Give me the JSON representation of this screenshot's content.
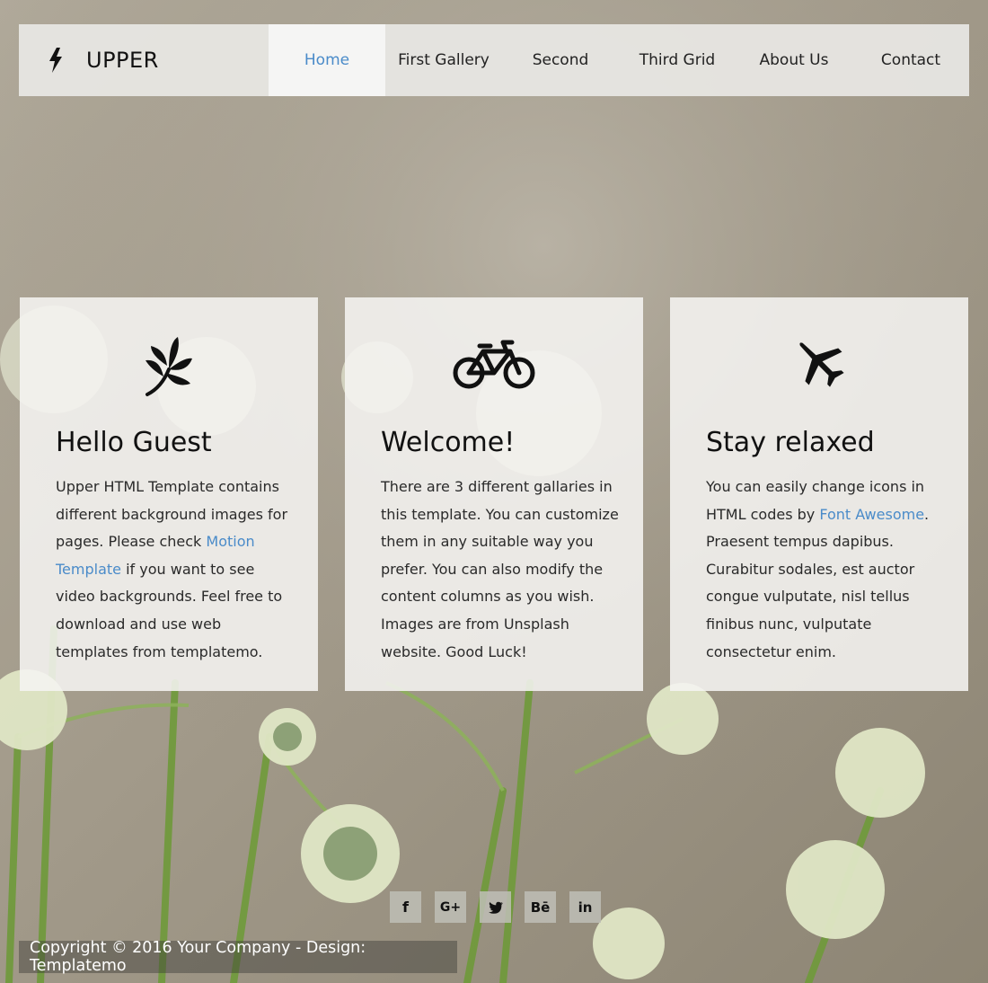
{
  "brand": {
    "name": "UPPER",
    "icon": "bolt-icon"
  },
  "nav": {
    "items": [
      {
        "label": "Home",
        "active": true
      },
      {
        "label": "First Gallery",
        "active": false
      },
      {
        "label": "Second",
        "active": false
      },
      {
        "label": "Third Grid",
        "active": false
      },
      {
        "label": "About Us",
        "active": false
      },
      {
        "label": "Contact",
        "active": false
      }
    ]
  },
  "cards": [
    {
      "icon": "leaf-icon",
      "title": "Hello Guest",
      "text_before": "Upper HTML Template contains different background images for pages. Please check ",
      "link": "Motion Template",
      "text_after": " if you want to see video backgrounds. Feel free to download and use web templates from templatemo."
    },
    {
      "icon": "bicycle-icon",
      "title": "Welcome!",
      "text": "There are 3 different gallaries in this template. You can customize them in any suitable way you prefer. You can also modify the content columns as you wish. Images are from Unsplash website. Good Luck!"
    },
    {
      "icon": "plane-icon",
      "title": "Stay relaxed",
      "text_before": "You can easily change icons in HTML codes by ",
      "link": "Font Awesome",
      "text_after": ". Praesent tempus dapibus. Curabitur sodales, est auctor congue vulputate, nisl tellus finibus nunc, vulputate consectetur enim."
    }
  ],
  "social": [
    {
      "label": "f",
      "icon": "facebook-icon"
    },
    {
      "label": "G+",
      "icon": "google-plus-icon"
    },
    {
      "label": "🐦",
      "icon": "twitter-icon"
    },
    {
      "label": "Bē",
      "icon": "behance-icon"
    },
    {
      "label": "in",
      "icon": "linkedin-icon"
    }
  ],
  "footer": {
    "copyright": "Copyright © 2016 Your Company - Design: Templatemo"
  },
  "colors": {
    "accent": "#4a8bc9",
    "card_bg": "#f5f4f1",
    "nav_bg": "#e8e7e4"
  }
}
